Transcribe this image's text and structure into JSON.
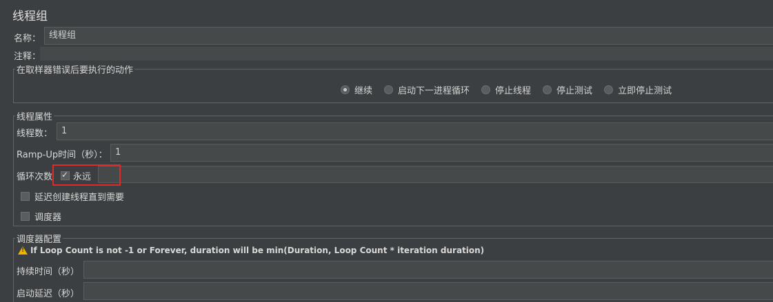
{
  "panel": {
    "title": "线程组"
  },
  "name_field": {
    "label": "名称：",
    "value": "线程组"
  },
  "comment_field": {
    "label": "注释：",
    "value": ""
  },
  "sampler_error": {
    "legend": "在取样器错误后要执行的动作",
    "options": [
      "继续",
      "启动下一进程循环",
      "停止线程",
      "停止测试",
      "立即停止测试"
    ],
    "selected_index": 0
  },
  "thread_props": {
    "legend": "线程属性",
    "thread_count_label": "线程数：",
    "thread_count_value": "1",
    "rampup_label": "Ramp-Up时间（秒）：",
    "rampup_value": "1",
    "loop_label": "循环次数",
    "forever_label": "永远",
    "forever_checked": true,
    "delay_label": "延迟创建线程直到需要",
    "delay_checked": false,
    "scheduler_label": "调度器",
    "scheduler_checked": false
  },
  "scheduler_config": {
    "legend": "调度器配置",
    "warning": "If Loop Count is not -1 or Forever, duration will be min(Duration, Loop Count * iteration duration)",
    "duration_label": "持续时间（秒）",
    "duration_value": "",
    "startup_delay_label": "启动延迟（秒）",
    "startup_delay_value": ""
  },
  "colors": {
    "background": "#3c3f41",
    "field": "#45494a",
    "highlight": "#e02a2a",
    "warning": "#f0b400"
  }
}
